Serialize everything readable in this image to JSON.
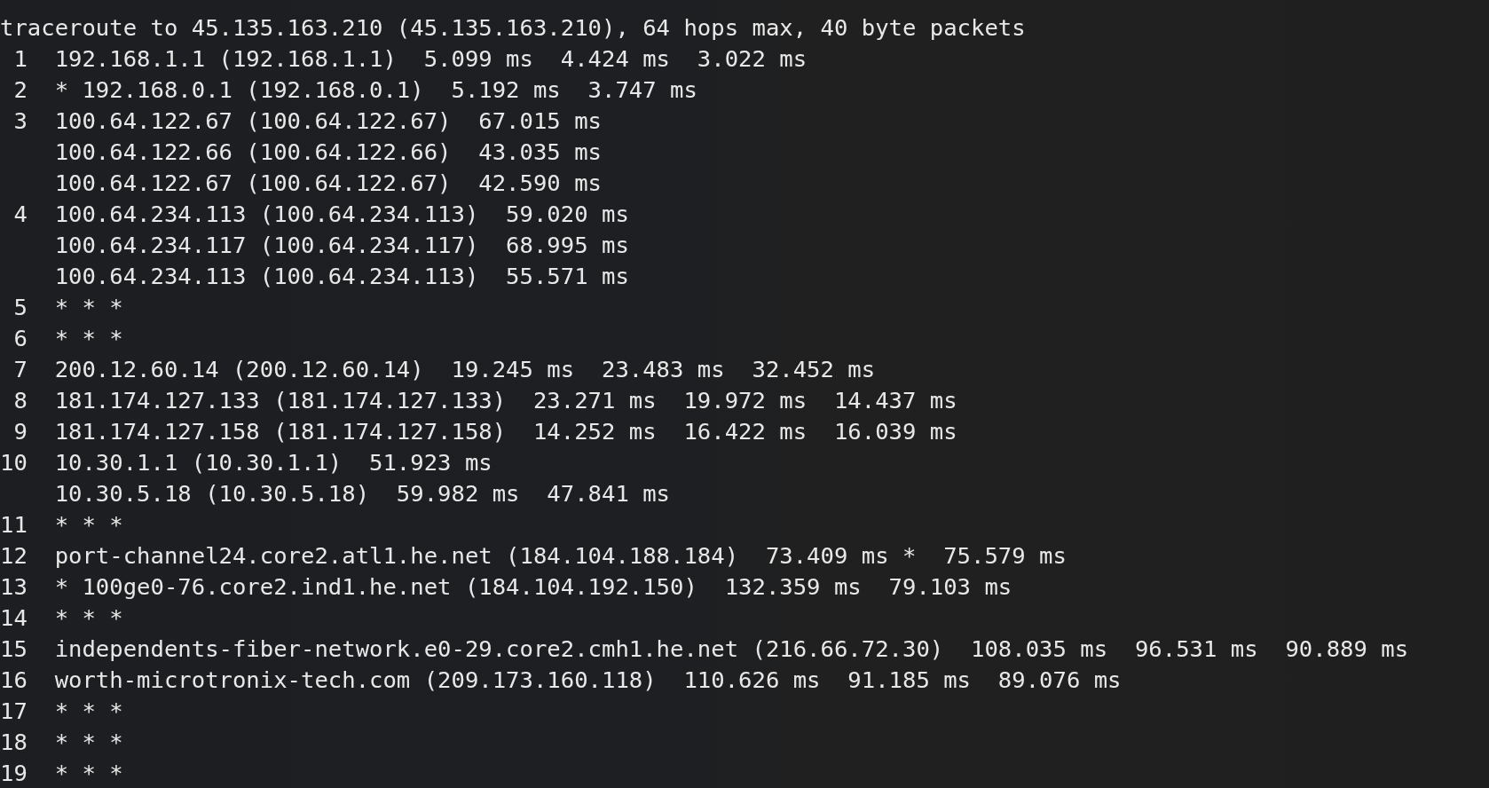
{
  "terminal": {
    "lines": [
      "traceroute to 45.135.163.210 (45.135.163.210), 64 hops max, 40 byte packets",
      " 1  192.168.1.1 (192.168.1.1)  5.099 ms  4.424 ms  3.022 ms",
      " 2  * 192.168.0.1 (192.168.0.1)  5.192 ms  3.747 ms",
      " 3  100.64.122.67 (100.64.122.67)  67.015 ms",
      "    100.64.122.66 (100.64.122.66)  43.035 ms",
      "    100.64.122.67 (100.64.122.67)  42.590 ms",
      " 4  100.64.234.113 (100.64.234.113)  59.020 ms",
      "    100.64.234.117 (100.64.234.117)  68.995 ms",
      "    100.64.234.113 (100.64.234.113)  55.571 ms",
      " 5  * * *",
      " 6  * * *",
      " 7  200.12.60.14 (200.12.60.14)  19.245 ms  23.483 ms  32.452 ms",
      " 8  181.174.127.133 (181.174.127.133)  23.271 ms  19.972 ms  14.437 ms",
      " 9  181.174.127.158 (181.174.127.158)  14.252 ms  16.422 ms  16.039 ms",
      "10  10.30.1.1 (10.30.1.1)  51.923 ms",
      "    10.30.5.18 (10.30.5.18)  59.982 ms  47.841 ms",
      "11  * * *",
      "12  port-channel24.core2.atl1.he.net (184.104.188.184)  73.409 ms *  75.579 ms",
      "13  * 100ge0-76.core2.ind1.he.net (184.104.192.150)  132.359 ms  79.103 ms",
      "14  * * *",
      "15  independents-fiber-network.e0-29.core2.cmh1.he.net (216.66.72.30)  108.035 ms  96.531 ms  90.889 ms",
      "16  worth-microtronix-tech.com (209.173.160.118)  110.626 ms  91.185 ms  89.076 ms",
      "17  * * *",
      "18  * * *",
      "19  * * *"
    ]
  }
}
